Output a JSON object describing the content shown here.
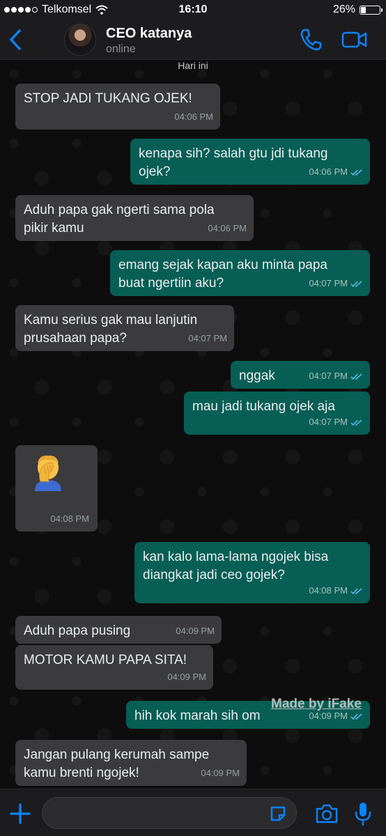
{
  "status_bar": {
    "carrier": "Telkomsel",
    "time": "16:10",
    "battery": "26%",
    "battery_level": 0.26,
    "signal_bars": 4
  },
  "header": {
    "contact_name": "CEO katanya",
    "contact_status": "online"
  },
  "chat": {
    "date_label": "Hari ini",
    "messages": [
      {
        "dir": "in",
        "text": "STOP JADI TUKANG OJEK!",
        "time": "04:06 PM"
      },
      {
        "dir": "out",
        "text": "kenapa sih? salah gtu jdi tukang\nojek?",
        "time": "04:06 PM"
      },
      {
        "dir": "in",
        "text": "Aduh papa gak ngerti sama pola\npikir kamu",
        "time": "04:06 PM"
      },
      {
        "dir": "out",
        "text": "emang sejak kapan aku minta papa\nbuat ngertiin aku?",
        "time": "04:07 PM"
      },
      {
        "dir": "in",
        "text": "Kamu serius gak mau lanjutin\nprusahaan papa?",
        "time": "04:07 PM"
      },
      {
        "dir": "out",
        "text": "nggak",
        "time": "04:07 PM"
      },
      {
        "dir": "out",
        "text": "mau jadi tukang ojek aja",
        "time": "04:07 PM"
      },
      {
        "dir": "in",
        "text": "",
        "emoji": "facepalm-emoji",
        "time": "04:08 PM"
      },
      {
        "dir": "out",
        "text": "kan kalo lama-lama ngojek bisa\ndiangkat jadi ceo gojek?",
        "time": "04:08 PM"
      },
      {
        "dir": "in",
        "text": "Aduh papa pusing",
        "time": "04:09 PM"
      },
      {
        "dir": "in",
        "text": "MOTOR KAMU PAPA SITA!",
        "time": "04:09 PM"
      },
      {
        "dir": "out",
        "text": "hih kok marah sih om",
        "time": "04:09 PM"
      },
      {
        "dir": "in",
        "text": "Jangan pulang kerumah sampe\nkamu brenti ngojek!",
        "time": "04:09 PM"
      }
    ],
    "watermark": "Made by iFake"
  },
  "input_bar": {
    "placeholder": ""
  },
  "colors": {
    "accent": "#0a84ff",
    "incoming_bubble": "#3b3b3d",
    "outgoing_bubble": "#075e54",
    "read_ticks": "#53bdeb"
  }
}
